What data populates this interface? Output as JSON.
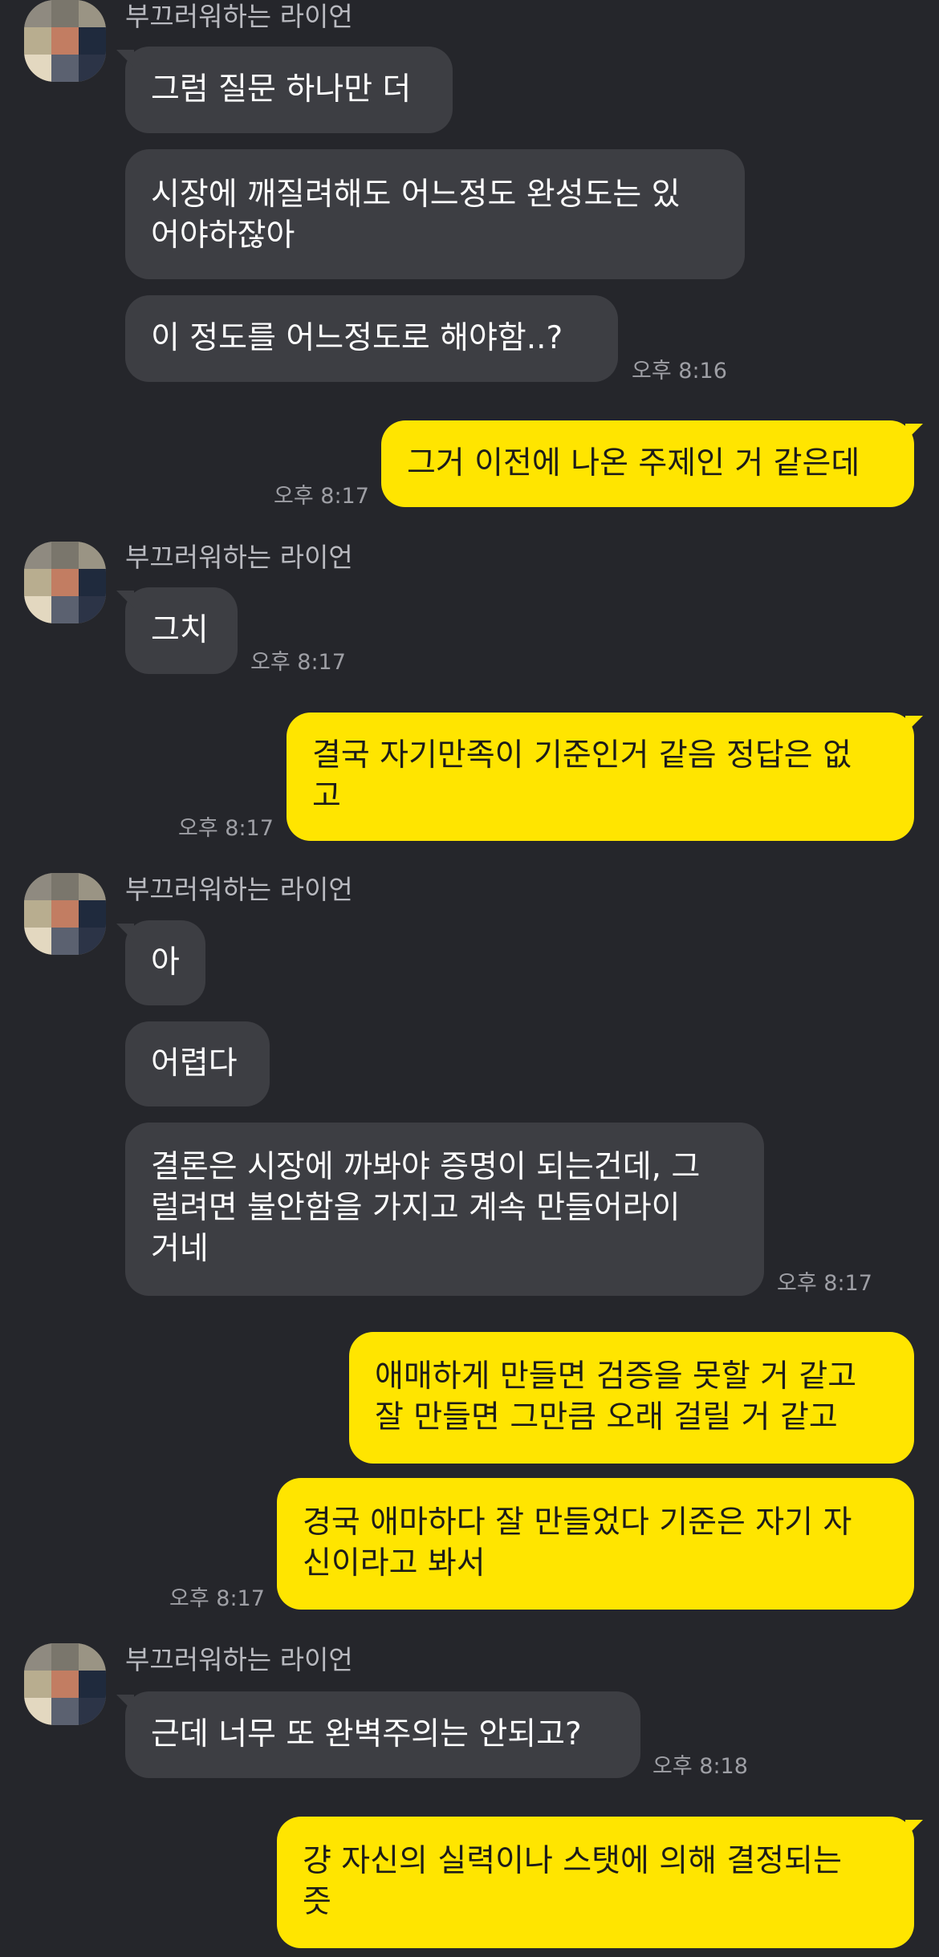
{
  "sender": {
    "name": "부끄러워하는 라이언"
  },
  "messages": [
    {
      "from": "them",
      "text": "그럼 질문 하나만 더"
    },
    {
      "from": "them",
      "text": "시장에 깨질려해도 어느정도 완성도는 있\n어야하잖아"
    },
    {
      "from": "them",
      "text": "이 정도를 어느정도로 해야함..?",
      "time": "오후 8:16"
    },
    {
      "from": "me",
      "text": "그거 이전에 나온 주제인 거 같은데",
      "time": "오후 8:17"
    },
    {
      "from": "them",
      "text": "그치",
      "time": "오후 8:17"
    },
    {
      "from": "me",
      "text": "결국 자기만족이 기준인거 같음 정답은 없\n고",
      "time": "오후 8:17"
    },
    {
      "from": "them",
      "text": "아"
    },
    {
      "from": "them",
      "text": "어렵다"
    },
    {
      "from": "them",
      "text": "결론은 시장에 까봐야 증명이 되는건데, 그\n럴려면 불안함을 가지고 계속 만들어라이\n거네",
      "time": "오후 8:17"
    },
    {
      "from": "me",
      "text": "애매하게 만들면 검증을 못할 거 같고\n잘 만들면 그만큼 오래 걸릴 거 같고"
    },
    {
      "from": "me",
      "text": "경국 애마하다 잘 만들었다 기준은 자기 자\n신이라고 봐서",
      "time": "오후 8:17"
    },
    {
      "from": "them",
      "text": "근데 너무 또 완벽주의는 안되고?",
      "time": "오후 8:18"
    },
    {
      "from": "me",
      "text": "걍 자신의 실력이나 스탯에 의해 결정되는\n즛"
    }
  ]
}
